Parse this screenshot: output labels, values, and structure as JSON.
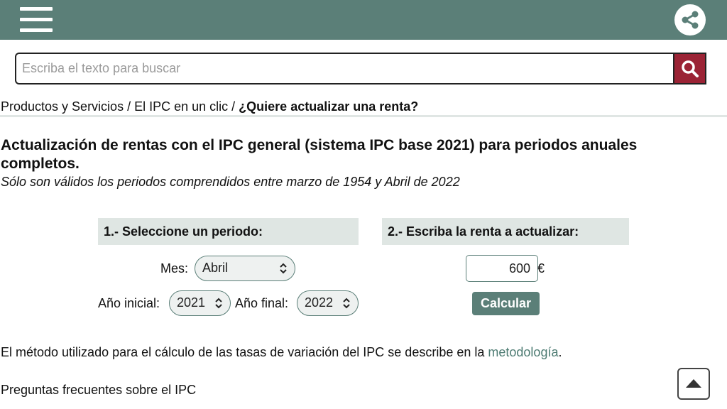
{
  "header": {
    "menu_icon": "hamburger-menu-icon",
    "share_icon": "share-icon"
  },
  "search": {
    "placeholder": "Escriba el texto para buscar",
    "value": "",
    "button_icon": "search-icon"
  },
  "breadcrumb": {
    "items": [
      "Productos y Servicios",
      "El IPC en un clic"
    ],
    "separator": " / ",
    "current": "¿Quiere actualizar una renta?"
  },
  "page": {
    "title": "Actualización de rentas con el IPC general (sistema IPC base 2021) para periodos anuales completos.",
    "subtitle": "Sólo son válidos los periodos comprendidos entre marzo de 1954 y Abril de 2022"
  },
  "step1": {
    "heading": "1.-  Seleccione un periodo:",
    "month_label": "Mes:",
    "month_value": "Abril",
    "start_year_label": "Año inicial:",
    "start_year_value": "2021",
    "end_year_label": "Año final:",
    "end_year_value": "2022"
  },
  "step2": {
    "heading": "2.-  Escriba la renta a actualizar:",
    "amount_value": "600",
    "currency": "€",
    "calculate_label": "Calcular"
  },
  "footer": {
    "method_text_before": "El método utilizado para el cálculo de las tasas de variación del IPC se describe en la ",
    "method_link": "metodología",
    "method_text_after": ".",
    "faq_link": "Preguntas frecuentes sobre el IPC",
    "back_to_top_icon": "arrow-up-icon"
  },
  "colors": {
    "header_bg": "#5b7f78",
    "search_button_bg": "#9b2335",
    "panel_bg": "#dfe6e3",
    "link": "#4d7b72"
  }
}
